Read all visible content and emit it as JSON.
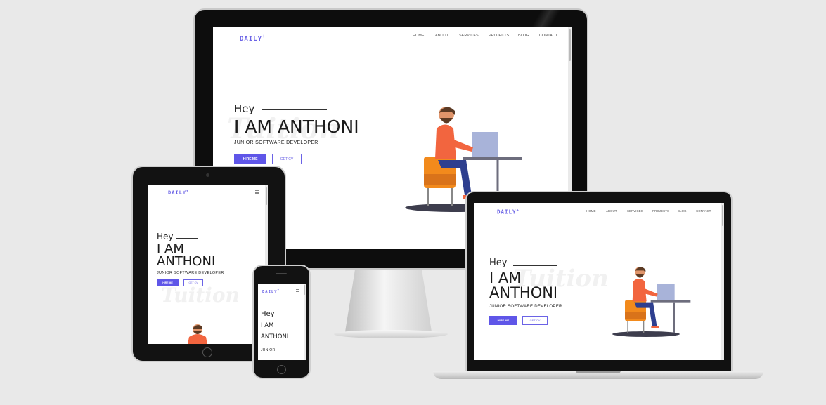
{
  "site": {
    "logo": "DAILY",
    "logo_mark": "+",
    "nav": [
      "HOME",
      "ABOUT",
      "SERVICES",
      "PROJECTS",
      "BLOG",
      "CONTACT"
    ],
    "greeting": "Hey",
    "name_line1": "I AM",
    "name_line2": "ANTHONI",
    "name_full": "I AM ANTHONI",
    "role": "JUNIOR SOFTWARE DEVELOPER",
    "role_short": "JUNIOR",
    "hire_button": "HIRE ME",
    "cv_button": "GET CV",
    "watermark": "Tuition",
    "menu_icon": "hamburger-icon"
  },
  "colors": {
    "accent": "#6b63e6",
    "button": "#5f56e8",
    "shirt": "#f2653f",
    "chair": "#f28a1c",
    "pants": "#2e3f8f",
    "laptop": "#a8b3d9",
    "background": "#e9e9e9"
  }
}
